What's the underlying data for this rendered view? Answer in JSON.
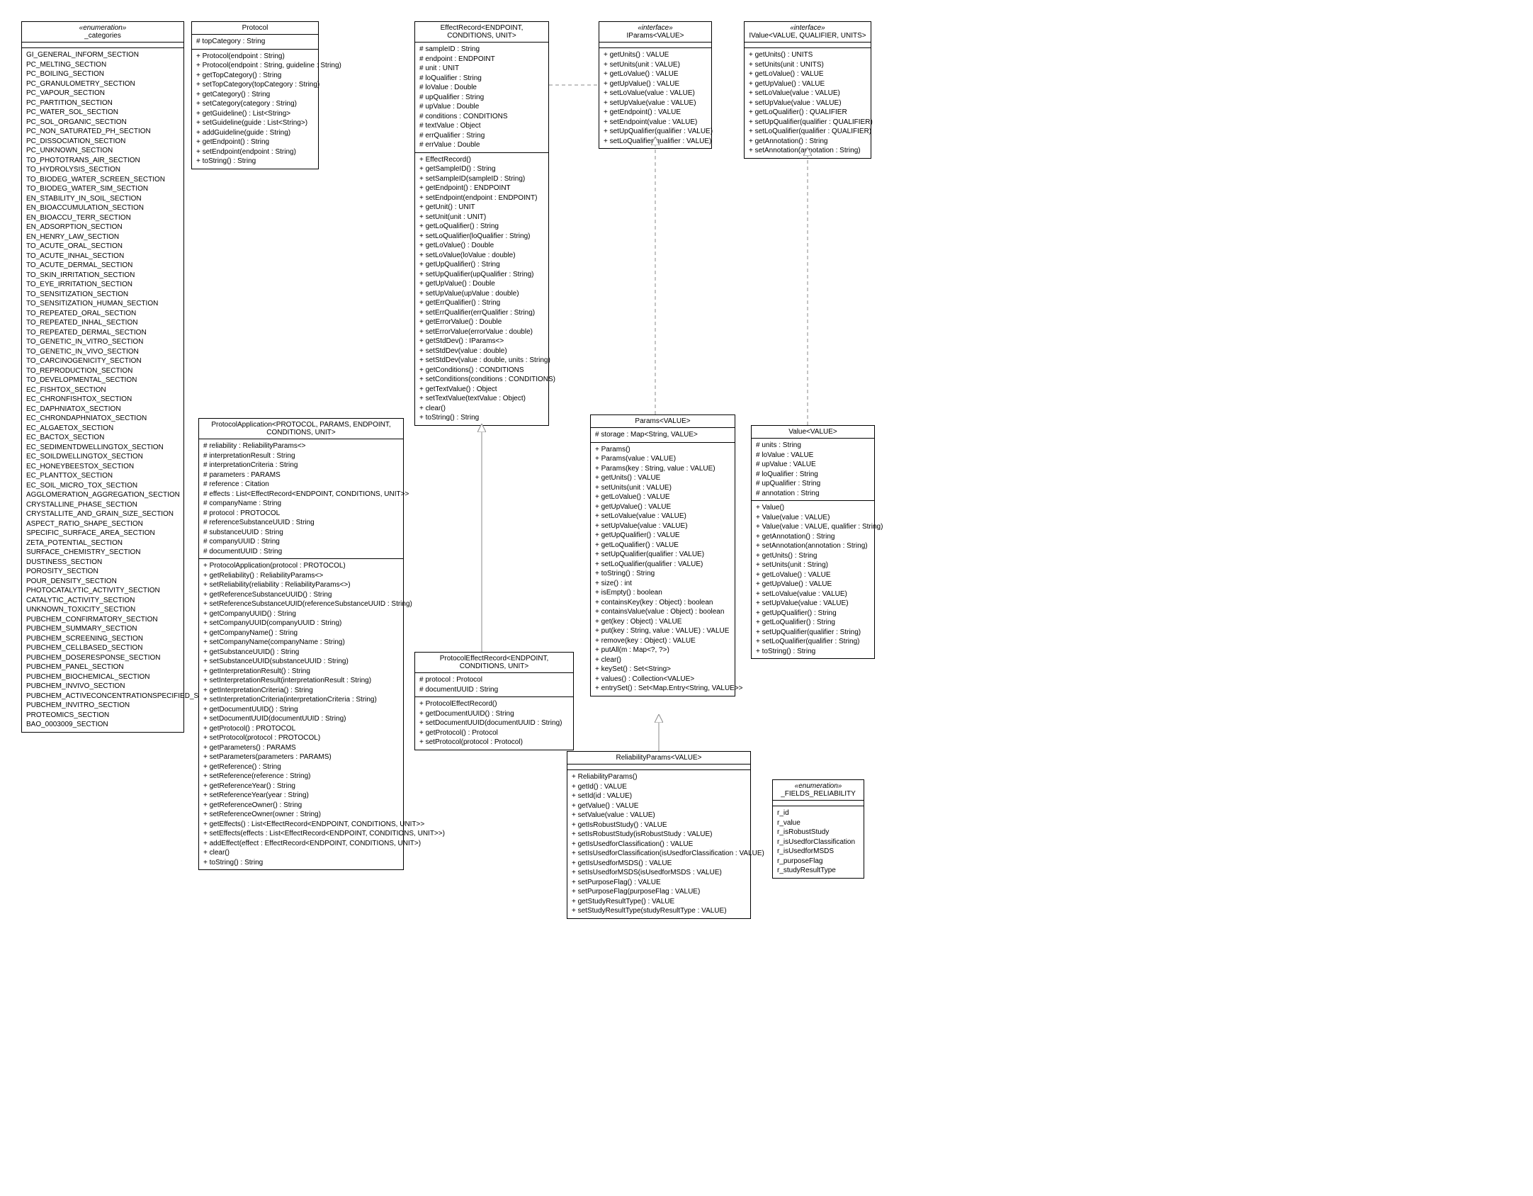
{
  "enum_categories": {
    "title_stereo": "«enumeration»",
    "title": "_categories",
    "items": [
      "GI_GENERAL_INFORM_SECTION",
      "PC_MELTING_SECTION",
      "PC_BOILING_SECTION",
      "PC_GRANULOMETRY_SECTION",
      "PC_VAPOUR_SECTION",
      "PC_PARTITION_SECTION",
      "PC_WATER_SOL_SECTION",
      "PC_SOL_ORGANIC_SECTION",
      "PC_NON_SATURATED_PH_SECTION",
      "PC_DISSOCIATION_SECTION",
      "PC_UNKNOWN_SECTION",
      "TO_PHOTOTRANS_AIR_SECTION",
      "TO_HYDROLYSIS_SECTION",
      "TO_BIODEG_WATER_SCREEN_SECTION",
      "TO_BIODEG_WATER_SIM_SECTION",
      "EN_STABILITY_IN_SOIL_SECTION",
      "EN_BIOACCUMULATION_SECTION",
      "EN_BIOACCU_TERR_SECTION",
      "EN_ADSORPTION_SECTION",
      "EN_HENRY_LAW_SECTION",
      "TO_ACUTE_ORAL_SECTION",
      "TO_ACUTE_INHAL_SECTION",
      "TO_ACUTE_DERMAL_SECTION",
      "TO_SKIN_IRRITATION_SECTION",
      "TO_EYE_IRRITATION_SECTION",
      "TO_SENSITIZATION_SECTION",
      "TO_SENSITIZATION_HUMAN_SECTION",
      "TO_REPEATED_ORAL_SECTION",
      "TO_REPEATED_INHAL_SECTION",
      "TO_REPEATED_DERMAL_SECTION",
      "TO_GENETIC_IN_VITRO_SECTION",
      "TO_GENETIC_IN_VIVO_SECTION",
      "TO_CARCINOGENICITY_SECTION",
      "TO_REPRODUCTION_SECTION",
      "TO_DEVELOPMENTAL_SECTION",
      "EC_FISHTOX_SECTION",
      "EC_CHRONFISHTOX_SECTION",
      "EC_DAPHNIATOX_SECTION",
      "EC_CHRONDAPHNIATOX_SECTION",
      "EC_ALGAETOX_SECTION",
      "EC_BACTOX_SECTION",
      "EC_SEDIMENTDWELLINGTOX_SECTION",
      "EC_SOILDWELLINGTOX_SECTION",
      "EC_HONEYBEESTOX_SECTION",
      "EC_PLANTTOX_SECTION",
      "EC_SOIL_MICRO_TOX_SECTION",
      "AGGLOMERATION_AGGREGATION_SECTION",
      "CRYSTALLINE_PHASE_SECTION",
      "CRYSTALLITE_AND_GRAIN_SIZE_SECTION",
      "ASPECT_RATIO_SHAPE_SECTION",
      "SPECIFIC_SURFACE_AREA_SECTION",
      "ZETA_POTENTIAL_SECTION",
      "SURFACE_CHEMISTRY_SECTION",
      "DUSTINESS_SECTION",
      "POROSITY_SECTION",
      "POUR_DENSITY_SECTION",
      "PHOTOCATALYTIC_ACTIVITY_SECTION",
      "CATALYTIC_ACTIVITY_SECTION",
      "UNKNOWN_TOXICITY_SECTION",
      "PUBCHEM_CONFIRMATORY_SECTION",
      "PUBCHEM_SUMMARY_SECTION",
      "PUBCHEM_SCREENING_SECTION",
      "PUBCHEM_CELLBASED_SECTION",
      "PUBCHEM_DOSERESPONSE_SECTION",
      "PUBCHEM_PANEL_SECTION",
      "PUBCHEM_BIOCHEMICAL_SECTION",
      "PUBCHEM_INVIVO_SECTION",
      "PUBCHEM_ACTIVECONCENTRATIONSPECIFIED_SECTION",
      "PUBCHEM_INVITRO_SECTION",
      "PROTEOMICS_SECTION",
      "BAO_0003009_SECTION"
    ]
  },
  "protocol": {
    "title": "Protocol",
    "attrs": [
      "# topCategory : String"
    ],
    "ops": [
      "+ Protocol(endpoint : String)",
      "+ Protocol(endpoint : String, guideline : String)",
      "+ getTopCategory() : String",
      "+ setTopCategory(topCategory : String)",
      "+ getCategory() : String",
      "+ setCategory(category : String)",
      "+ getGuideline() : List<String>",
      "+ setGuideline(guide : List<String>)",
      "+ addGuideline(guide : String)",
      "+ getEndpoint() : String",
      "+ setEndpoint(endpoint : String)",
      "+ toString() : String"
    ]
  },
  "effectRecord": {
    "title": "EffectRecord<ENDPOINT, CONDITIONS, UNIT>",
    "attrs": [
      "# sampleID : String",
      "# endpoint : ENDPOINT",
      "# unit : UNIT",
      "# loQualifier : String",
      "# loValue : Double",
      "# upQualifier : String",
      "# upValue : Double",
      "# conditions : CONDITIONS",
      "# textValue : Object",
      "# errQualifier : String",
      "# errValue : Double"
    ],
    "ops": [
      "+ EffectRecord()",
      "+ getSampleID() : String",
      "+ setSampleID(sampleID : String)",
      "+ getEndpoint() : ENDPOINT",
      "+ setEndpoint(endpoint : ENDPOINT)",
      "+ getUnit() : UNIT",
      "+ setUnit(unit : UNIT)",
      "+ getLoQualifier() : String",
      "+ setLoQualifier(loQualifier : String)",
      "+ getLoValue() : Double",
      "+ setLoValue(loValue : double)",
      "+ getUpQualifier() : String",
      "+ setUpQualifier(upQualifier : String)",
      "+ getUpValue() : Double",
      "+ setUpValue(upValue : double)",
      "+ getErrQualifier() : String",
      "+ setErrQualifier(errQualifier : String)",
      "+ getErrorValue() : Double",
      "+ setErrorValue(errorValue : double)",
      "+ getStdDev() : IParams<>",
      "+ setStdDev(value : double)",
      "+ setStdDev(value : double, units : String)",
      "+ getConditions() : CONDITIONS",
      "+ setConditions(conditions : CONDITIONS)",
      "+ getTextValue() : Object",
      "+ setTextValue(textValue : Object)",
      "+ clear()",
      "+ toString() : String"
    ]
  },
  "iparams": {
    "title_stereo": "«interface»",
    "title": "IParams<VALUE>",
    "ops": [
      "+ getUnits() : VALUE",
      "+ setUnits(unit : VALUE)",
      "+ getLoValue() : VALUE",
      "+ getUpValue() : VALUE",
      "+ setLoValue(value : VALUE)",
      "+ setUpValue(value : VALUE)",
      "+ getEndpoint() : VALUE",
      "+ setEndpoint(value : VALUE)",
      "+ setUpQualifier(qualifier : VALUE)",
      "+ setLoQualifier(qualifier : VALUE)"
    ]
  },
  "ivalue": {
    "title_stereo": "«interface»",
    "title": "IValue<VALUE, QUALIFIER, UNITS>",
    "ops": [
      "+ getUnits() : UNITS",
      "+ setUnits(unit : UNITS)",
      "+ getLoValue() : VALUE",
      "+ getUpValue() : VALUE",
      "+ setLoValue(value : VALUE)",
      "+ setUpValue(value : VALUE)",
      "+ getLoQualifier() : QUALIFIER",
      "+ setUpQualifier(qualifier : QUALIFIER)",
      "+ setLoQualifier(qualifier : QUALIFIER)",
      "+ getAnnotation() : String",
      "+ setAnnotation(annotation : String)"
    ]
  },
  "protocolApplication": {
    "title": "ProtocolApplication<PROTOCOL, PARAMS, ENDPOINT, CONDITIONS, UNIT>",
    "attrs": [
      "# reliability : ReliabilityParams<>",
      "# interpretationResult : String",
      "# interpretationCriteria : String",
      "# parameters : PARAMS",
      "# reference : Citation",
      "# effects : List<EffectRecord<ENDPOINT, CONDITIONS, UNIT>>",
      "# companyName : String",
      "# protocol : PROTOCOL",
      "# referenceSubstanceUUID : String",
      "# substanceUUID : String",
      "# companyUUID : String",
      "# documentUUID : String"
    ],
    "ops": [
      "+ ProtocolApplication(protocol : PROTOCOL)",
      "+ getReliability() : ReliabilityParams<>",
      "+ setReliability(reliability : ReliabilityParams<>)",
      "+ getReferenceSubstanceUUID() : String",
      "+ setReferenceSubstanceUUID(referenceSubstanceUUID : String)",
      "+ getCompanyUUID() : String",
      "+ setCompanyUUID(companyUUID : String)",
      "+ getCompanyName() : String",
      "+ setCompanyName(companyName : String)",
      "+ getSubstanceUUID() : String",
      "+ setSubstanceUUID(substanceUUID : String)",
      "+ getInterpretationResult() : String",
      "+ setInterpretationResult(interpretationResult : String)",
      "+ getInterpretationCriteria() : String",
      "+ setInterpretationCriteria(interpretationCriteria : String)",
      "+ getDocumentUUID() : String",
      "+ setDocumentUUID(documentUUID : String)",
      "+ getProtocol() : PROTOCOL",
      "+ setProtocol(protocol : PROTOCOL)",
      "+ getParameters() : PARAMS",
      "+ setParameters(parameters : PARAMS)",
      "+ getReference() : String",
      "+ setReference(reference : String)",
      "+ getReferenceYear() : String",
      "+ setReferenceYear(year : String)",
      "+ getReferenceOwner() : String",
      "+ setReferenceOwner(owner : String)",
      "+ getEffects() : List<EffectRecord<ENDPOINT, CONDITIONS, UNIT>>",
      "+ setEffects(effects : List<EffectRecord<ENDPOINT, CONDITIONS, UNIT>>)",
      "+ addEffect(effect : EffectRecord<ENDPOINT, CONDITIONS, UNIT>)",
      "+ clear()",
      "+ toString() : String"
    ]
  },
  "protocolEffectRecord": {
    "title": "ProtocolEffectRecord<ENDPOINT, CONDITIONS, UNIT>",
    "attrs": [
      "# protocol : Protocol",
      "# documentUUID : String"
    ],
    "ops": [
      "+ ProtocolEffectRecord()",
      "+ getDocumentUUID() : String",
      "+ setDocumentUUID(documentUUID : String)",
      "+ getProtocol() : Protocol",
      "+ setProtocol(protocol : Protocol)"
    ]
  },
  "params": {
    "title": "Params<VALUE>",
    "attrs": [
      "# storage : Map<String, VALUE>"
    ],
    "ops": [
      "+ Params()",
      "+ Params(value : VALUE)",
      "+ Params(key : String, value : VALUE)",
      "+ getUnits() : VALUE",
      "+ setUnits(unit : VALUE)",
      "+ getLoValue() : VALUE",
      "+ getUpValue() : VALUE",
      "+ setLoValue(value : VALUE)",
      "+ setUpValue(value : VALUE)",
      "+ getUpQualifier() : VALUE",
      "+ getLoQualifier() : VALUE",
      "+ setUpQualifier(qualifier : VALUE)",
      "+ setLoQualifier(qualifier : VALUE)",
      "+ toString() : String",
      "+ size() : int",
      "+ isEmpty() : boolean",
      "+ containsKey(key : Object) : boolean",
      "+ containsValue(value : Object) : boolean",
      "+ get(key : Object) : VALUE",
      "+ put(key : String, value : VALUE) : VALUE",
      "+ remove(key : Object) : VALUE",
      "+ putAll(m : Map<?, ?>)",
      "+ clear()",
      "+ keySet() : Set<String>",
      "+ values() : Collection<VALUE>",
      "+ entrySet() : Set<Map.Entry<String, VALUE>>"
    ]
  },
  "valueClass": {
    "title": "Value<VALUE>",
    "attrs": [
      "# units : String",
      "# loValue : VALUE",
      "# upValue : VALUE",
      "# loQualifier : String",
      "# upQualifier : String",
      "# annotation : String"
    ],
    "ops": [
      "+ Value()",
      "+ Value(value : VALUE)",
      "+ Value(value : VALUE, qualifier : String)",
      "+ getAnnotation() : String",
      "+ setAnnotation(annotation : String)",
      "+ getUnits() : String",
      "+ setUnits(unit : String)",
      "+ getLoValue() : VALUE",
      "+ getUpValue() : VALUE",
      "+ setLoValue(value : VALUE)",
      "+ setUpValue(value : VALUE)",
      "+ getUpQualifier() : String",
      "+ getLoQualifier() : String",
      "+ setUpQualifier(qualifier : String)",
      "+ setLoQualifier(qualifier : String)",
      "+ toString() : String"
    ]
  },
  "reliabilityParams": {
    "title": "ReliabilityParams<VALUE>",
    "ops": [
      "+ ReliabilityParams()",
      "+ getId() : VALUE",
      "+ setId(id : VALUE)",
      "+ getValue() : VALUE",
      "+ setValue(value : VALUE)",
      "+ getIsRobustStudy() : VALUE",
      "+ setIsRobustStudy(isRobustStudy : VALUE)",
      "+ getIsUsedforClassification() : VALUE",
      "+ setIsUsedforClassification(isUsedforClassification : VALUE)",
      "+ getIsUsedforMSDS() : VALUE",
      "+ setIsUsedforMSDS(isUsedforMSDS : VALUE)",
      "+ setPurposeFlag() : VALUE",
      "+ setPurposeFlag(purposeFlag : VALUE)",
      "+ getStudyResultType() : VALUE",
      "+ setStudyResultType(studyResultType : VALUE)"
    ]
  },
  "fieldsReliability": {
    "title_stereo": "«enumeration»",
    "title": "_FIELDS_RELIABILITY",
    "items": [
      "r_id",
      "r_value",
      "r_isRobustStudy",
      "r_isUsedforClassification",
      "r_isUsedforMSDS",
      "r_purposeFlag",
      "r_studyResultType"
    ]
  }
}
